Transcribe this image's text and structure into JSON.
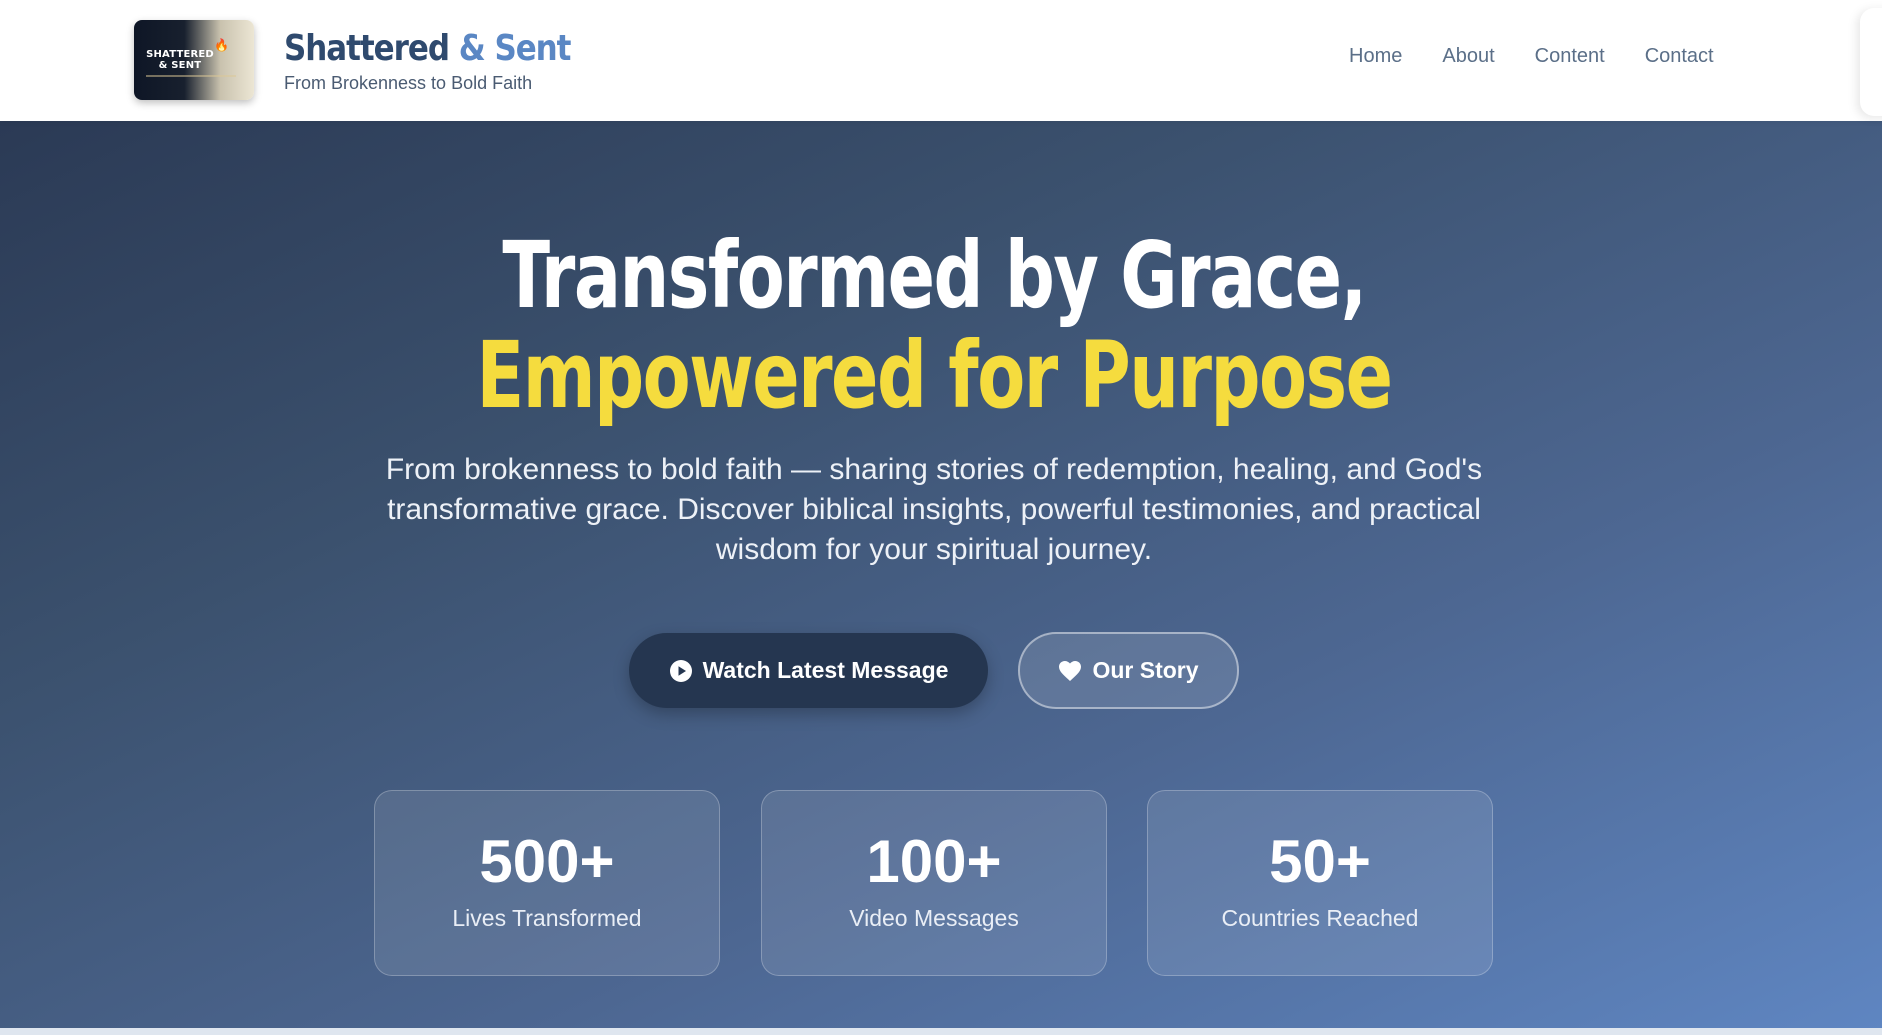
{
  "brand": {
    "logo_text": "SHATTERED & SENT",
    "title_part1": "Shattered",
    "title_part2": "& Sent",
    "tagline": "From Brokenness to Bold Faith"
  },
  "nav": {
    "items": [
      {
        "label": "Home"
      },
      {
        "label": "About"
      },
      {
        "label": "Content"
      },
      {
        "label": "Contact"
      }
    ]
  },
  "hero": {
    "headline_line1": "Transformed by Grace,",
    "headline_line2": "Empowered for Purpose",
    "subtext": "From brokenness to bold faith — sharing stories of redemption, healing, and God's transformative grace. Discover biblical insights, powerful testimonies, and practical wisdom for your spiritual journey.",
    "primary_button": "Watch Latest Message",
    "secondary_button": "Our Story"
  },
  "stats": [
    {
      "value": "500+",
      "label": "Lives Transformed"
    },
    {
      "value": "100+",
      "label": "Video Messages"
    },
    {
      "value": "50+",
      "label": "Countries Reached"
    }
  ],
  "colors": {
    "brand_dark": "#2f4a6e",
    "brand_light": "#5a87c4",
    "accent_yellow": "#f5dc3e",
    "button_dark": "#253650",
    "nav_text": "#5b6f88"
  },
  "icons": {
    "primary_button_icon": "play-circle-icon",
    "secondary_button_icon": "heart-icon"
  }
}
